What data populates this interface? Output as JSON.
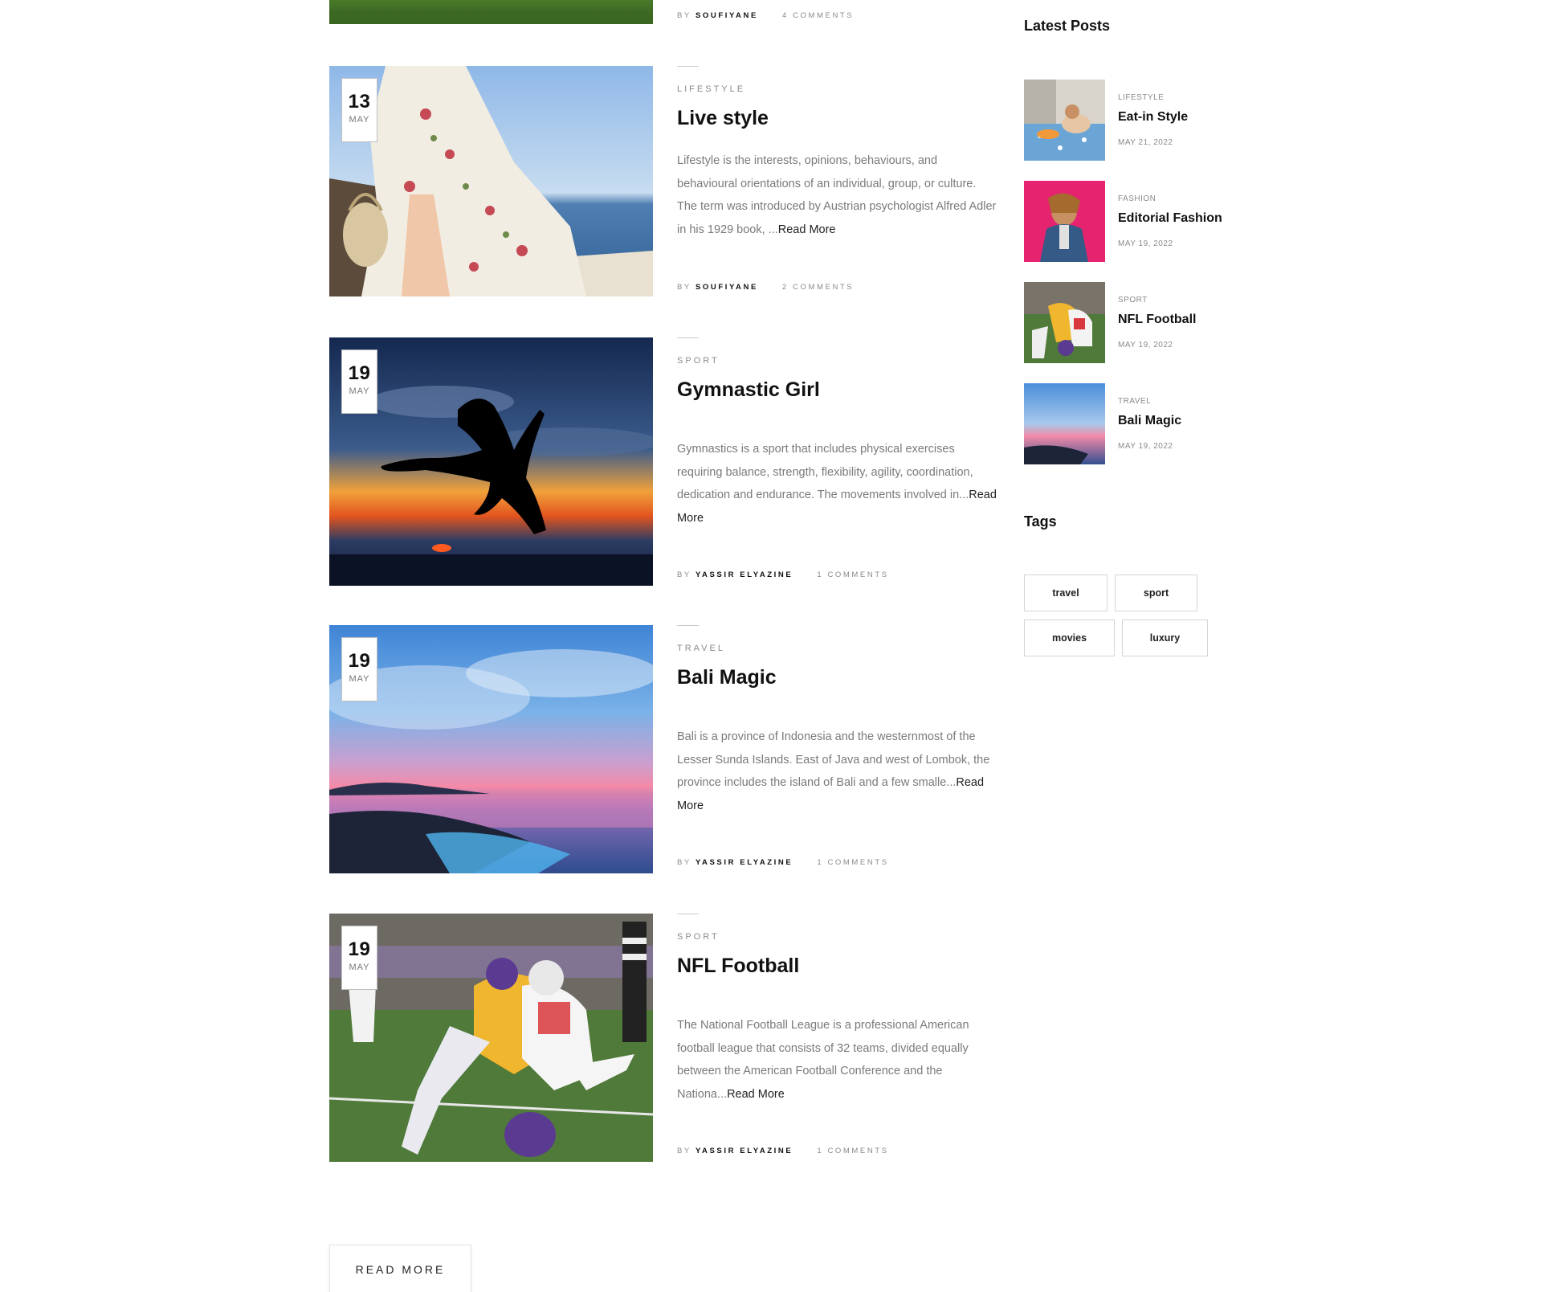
{
  "top_post_meta": {
    "by": "BY",
    "author": "SOUFIYANE",
    "comments": "4 COMMENTS"
  },
  "posts": [
    {
      "day": "13",
      "month": "MAY",
      "category": "LIFESTYLE",
      "title": "Live style",
      "excerpt": "Lifestyle is the interests, opinions, behaviours, and behavioural orientations of an individual, group, or culture. The term was introduced by Austrian psychologist Alfred Adler in his 1929 book, ...",
      "read_more": "Read More",
      "by": "BY",
      "author": "SOUFIYANE",
      "comments": "2 COMMENTS"
    },
    {
      "day": "19",
      "month": "MAY",
      "category": "SPORT",
      "title": "Gymnastic Girl",
      "excerpt": "Gymnastics is a sport that includes physical exercises requiring balance, strength, flexibility, agility, coordination, dedication and endurance. The movements involved in...",
      "read_more": "Read More",
      "by": "BY",
      "author": "YASSIR ELYAZINE",
      "comments": "1 COMMENTS"
    },
    {
      "day": "19",
      "month": "MAY",
      "category": "TRAVEL",
      "title": "Bali Magic",
      "excerpt": "Bali is a province of Indonesia and the westernmost of the Lesser Sunda Islands. East of Java and west of Lombok, the province includes the island of Bali and a few smalle...",
      "read_more": "Read More",
      "by": "BY",
      "author": "YASSIR ELYAZINE",
      "comments": "1 COMMENTS"
    },
    {
      "day": "19",
      "month": "MAY",
      "category": "SPORT",
      "title": "NFL Football",
      "excerpt": "The National Football League is a professional American football league that consists of 32 teams, divided equally between the American Football Conference and the Nationa...",
      "read_more": "Read More",
      "by": "BY",
      "author": "YASSIR ELYAZINE",
      "comments": "1 COMMENTS"
    }
  ],
  "sidebar": {
    "latest_heading": "Latest Posts",
    "latest": [
      {
        "category": "LIFESTYLE",
        "title": "Eat-in Style",
        "date": "MAY 21, 2022"
      },
      {
        "category": "FASHION",
        "title": "Editorial Fashion",
        "date": "MAY 19, 2022"
      },
      {
        "category": "SPORT",
        "title": "NFL Football",
        "date": "MAY 19, 2022"
      },
      {
        "category": "TRAVEL",
        "title": "Bali Magic",
        "date": "MAY 19, 2022"
      }
    ],
    "tags_heading": "Tags",
    "tags": [
      "travel",
      "sport",
      "movies",
      "luxury"
    ]
  },
  "read_more_button": "READ MORE"
}
